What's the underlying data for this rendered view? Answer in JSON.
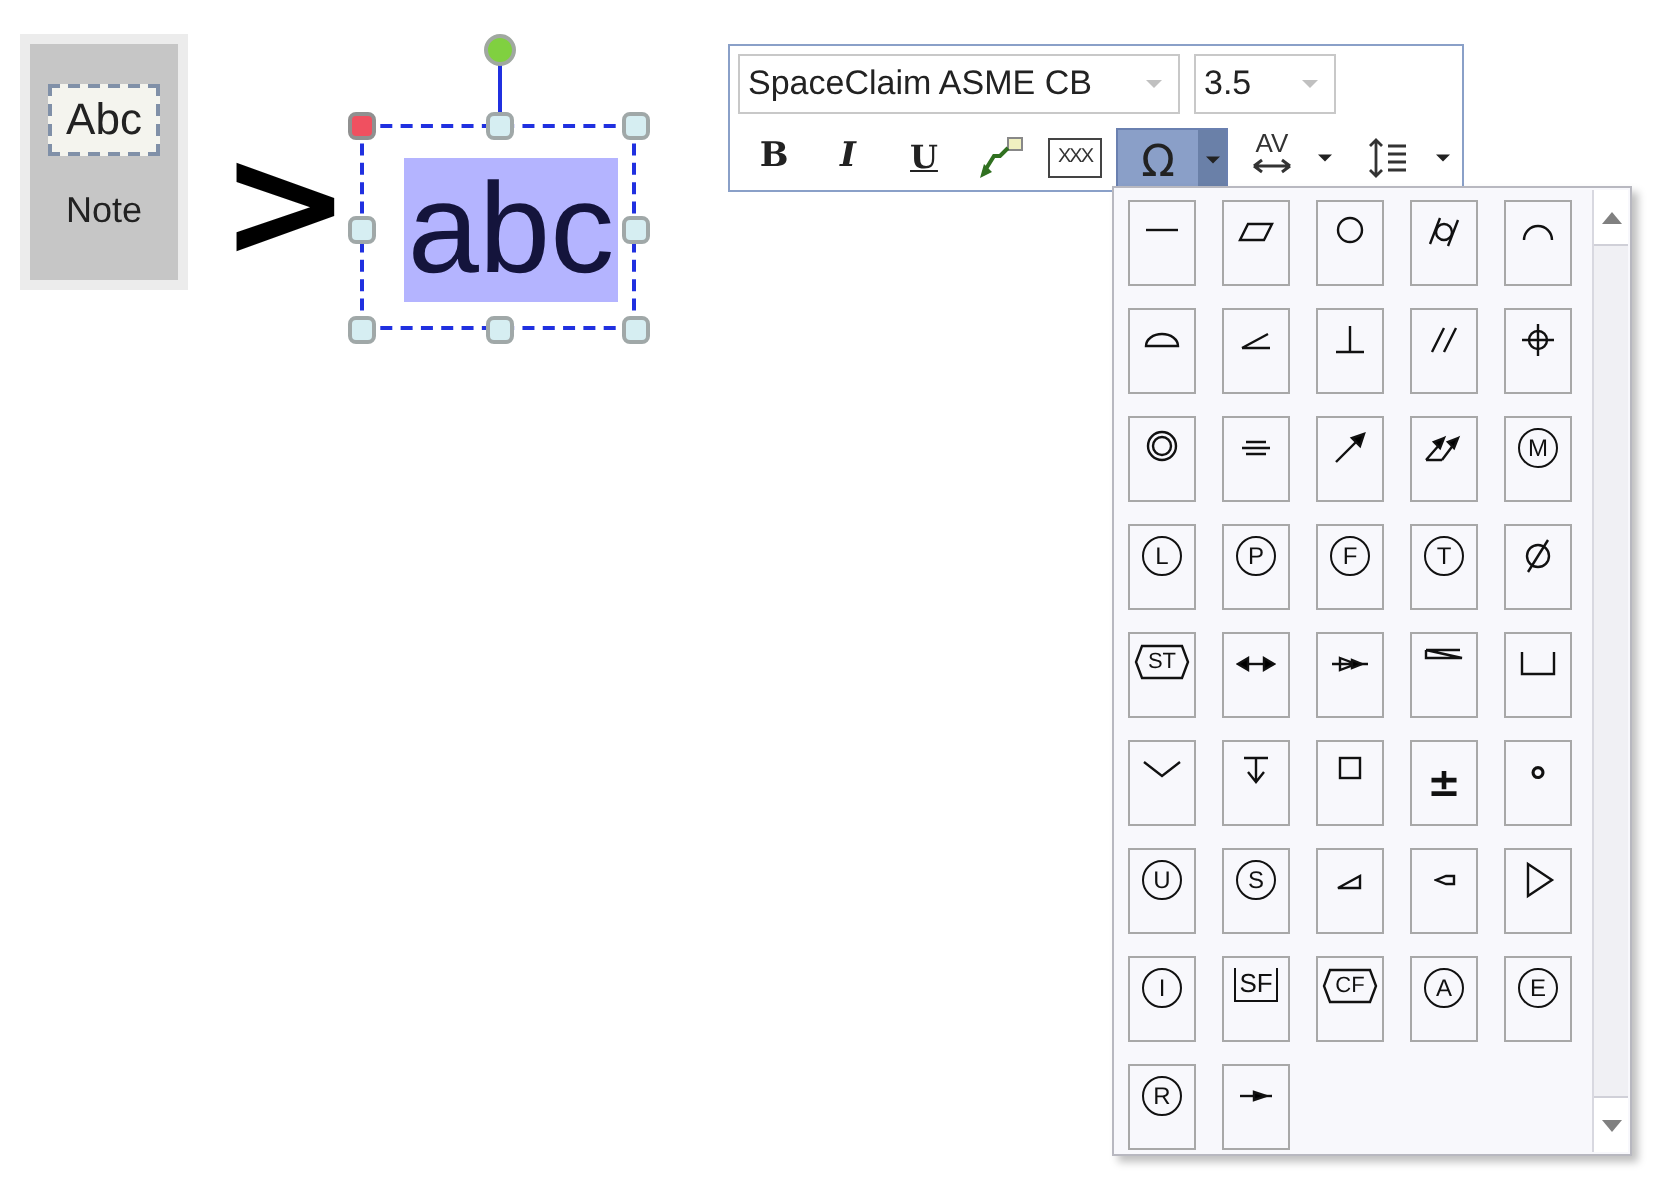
{
  "note_button": {
    "icon_text": "Abc",
    "label": "Note"
  },
  "arrow_glyph": ">",
  "canvas_text": {
    "text": "abc",
    "selected": true
  },
  "toolbar": {
    "font": "SpaceClaim ASME CB",
    "size": "3.5",
    "bold": "B",
    "italic": "I",
    "underline": "U",
    "field": "XXX",
    "symbol": "Ω",
    "symbol_menu_open": true,
    "spacing": "AV"
  },
  "symbols": [
    {
      "kind": "line"
    },
    {
      "kind": "parallelogram"
    },
    {
      "kind": "circle"
    },
    {
      "kind": "cylinder"
    },
    {
      "kind": "arc"
    },
    {
      "kind": "half_disc"
    },
    {
      "kind": "angle"
    },
    {
      "kind": "perpendicular"
    },
    {
      "kind": "parallel"
    },
    {
      "kind": "crosshair"
    },
    {
      "kind": "double_circle"
    },
    {
      "kind": "three_lines"
    },
    {
      "kind": "arrow"
    },
    {
      "kind": "double_arrow"
    },
    {
      "kind": "circled",
      "text": "M"
    },
    {
      "kind": "circled",
      "text": "L"
    },
    {
      "kind": "circled",
      "text": "P"
    },
    {
      "kind": "circled",
      "text": "F"
    },
    {
      "kind": "circled",
      "text": "T"
    },
    {
      "kind": "diameter"
    },
    {
      "kind": "hexagon",
      "text": "ST"
    },
    {
      "kind": "arrow_both"
    },
    {
      "kind": "cone_arrow"
    },
    {
      "kind": "slope"
    },
    {
      "kind": "counterbore"
    },
    {
      "kind": "countersink"
    },
    {
      "kind": "depth"
    },
    {
      "kind": "square"
    },
    {
      "kind": "char",
      "text": "±"
    },
    {
      "kind": "char",
      "text": "°"
    },
    {
      "kind": "circled",
      "text": "U"
    },
    {
      "kind": "circled",
      "text": "S"
    },
    {
      "kind": "wedge"
    },
    {
      "kind": "small_wedge"
    },
    {
      "kind": "triangle"
    },
    {
      "kind": "circled",
      "text": "I"
    },
    {
      "kind": "bracket",
      "text": "SF"
    },
    {
      "kind": "hexagon",
      "text": "CF"
    },
    {
      "kind": "circled",
      "text": "A"
    },
    {
      "kind": "circled",
      "text": "E"
    },
    {
      "kind": "circled",
      "text": "R"
    },
    {
      "kind": "origin_line"
    }
  ]
}
